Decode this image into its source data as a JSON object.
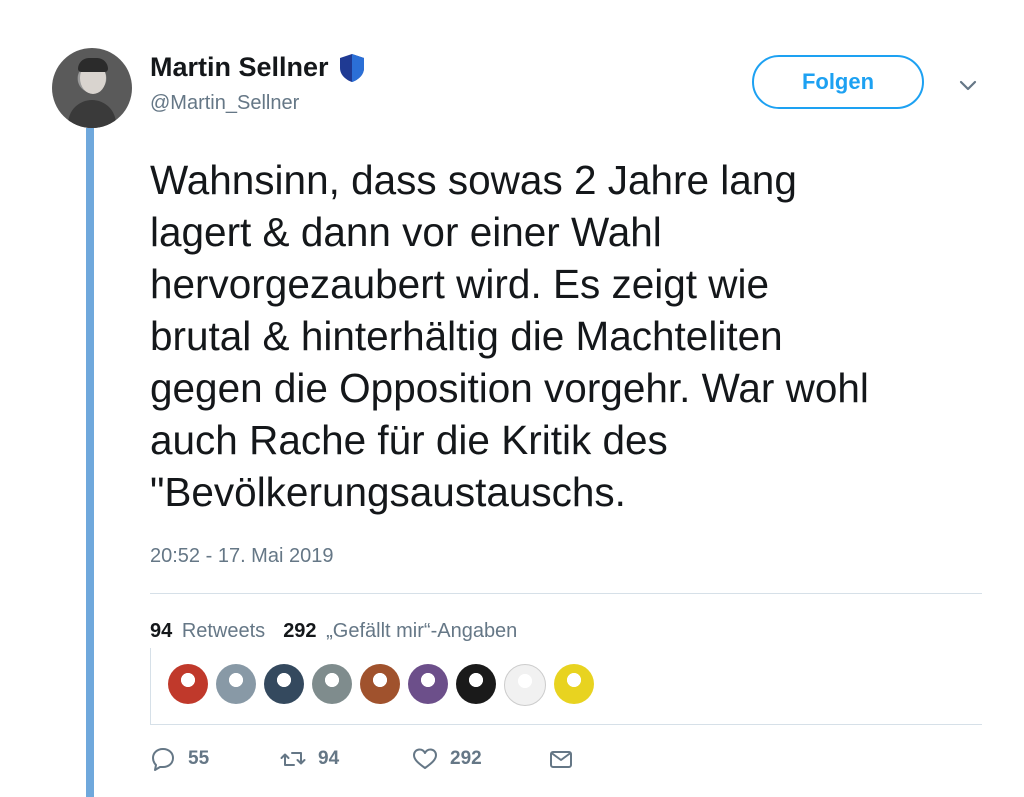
{
  "author": {
    "display_name": "Martin Sellner",
    "handle": "@Martin_Sellner",
    "verified_badge_icon": "shield-badge-icon"
  },
  "follow_button": {
    "label": "Folgen"
  },
  "more_menu": {
    "icon": "chevron-down-icon"
  },
  "tweet": {
    "text": "Wahnsinn, dass sowas 2 Jahre lang\nlagert & dann vor einer Wahl\nhervorgezaubert wird.  Es zeigt  wie\nbrutal & hinterhältig die Machteliten\ngegen die Opposition vorgehr. War wohl\nauch Rache für die Kritik des\n\"Bevölkerungsaustauschs.",
    "timestamp": "20:52 - 17. Mai 2019"
  },
  "stats": {
    "retweets_count": "94",
    "retweets_label": "Retweets",
    "likes_count": "292",
    "likes_label": "„Gefällt mir“-Angaben"
  },
  "likers": [
    {
      "icon": "liker-avatar-1",
      "color": "#c0392b"
    },
    {
      "icon": "liker-avatar-2",
      "color": "#8899a6"
    },
    {
      "icon": "liker-avatar-3",
      "color": "#34495e"
    },
    {
      "icon": "liker-avatar-4",
      "color": "#7f8c8d"
    },
    {
      "icon": "liker-avatar-5",
      "color": "#a0522d"
    },
    {
      "icon": "liker-avatar-6",
      "color": "#6c4f8a"
    },
    {
      "icon": "liker-avatar-7",
      "color": "#1a1a1a"
    },
    {
      "icon": "liker-avatar-8",
      "color": "#f1f1f1"
    },
    {
      "icon": "liker-avatar-9",
      "color": "#e8d320"
    }
  ],
  "actions": {
    "reply_count": "55",
    "retweet_count": "94",
    "like_count": "292",
    "icons": [
      "reply-icon",
      "retweet-icon",
      "heart-icon",
      "message-icon"
    ]
  },
  "colors": {
    "accent": "#1da1f2",
    "thread_line": "#6fa8dc",
    "secondary_text": "#657786"
  }
}
